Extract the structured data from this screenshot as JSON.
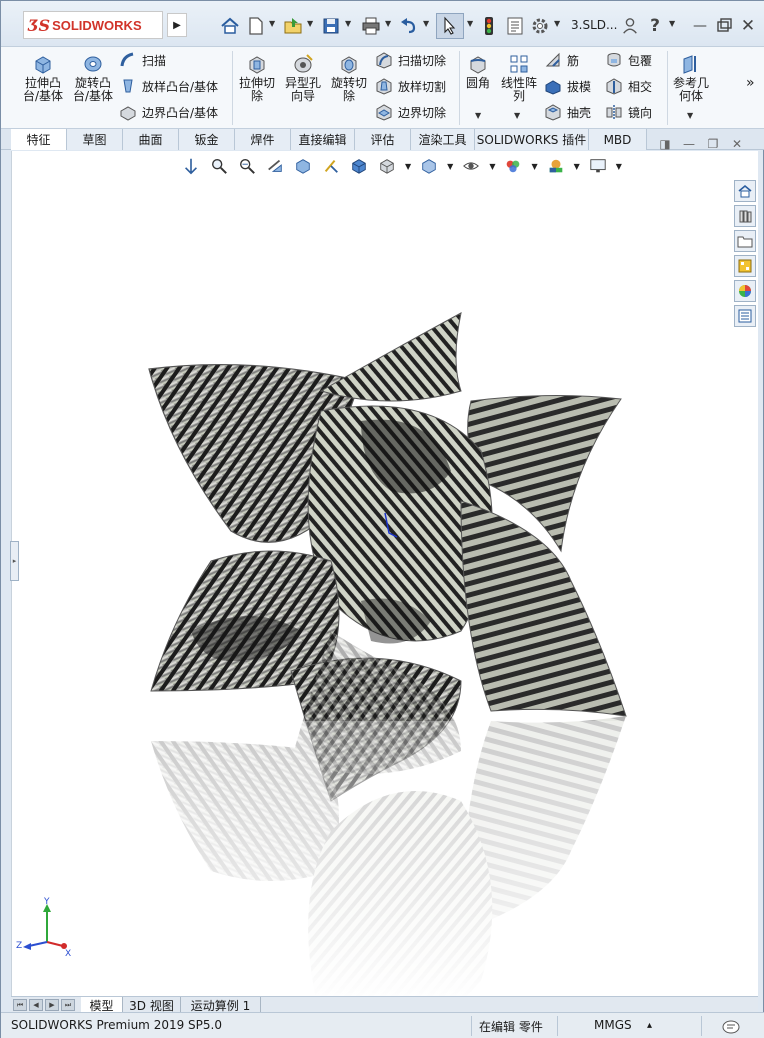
{
  "app": {
    "logo_text": "SOLIDWORKS",
    "file_name": "3.SLD..."
  },
  "quick_access": {
    "icons": [
      "home-icon",
      "new-document-icon",
      "open-icon",
      "save-icon",
      "print-icon",
      "undo-icon",
      "select-icon",
      "rebuild-icon",
      "file-properties-icon",
      "options-icon",
      "user-icon",
      "help-icon",
      "minimize-icon",
      "close-icon"
    ]
  },
  "ribbon": {
    "extrude_boss": "拉伸凸\n台/基体",
    "revolve_boss": "旋转凸\n台/基体",
    "sweep": "扫描",
    "loft_boss": "放样凸台/基体",
    "boundary_boss": "边界凸台/基体",
    "extrude_cut": "拉伸切\n除",
    "hole_wizard": "异型孔\n向导",
    "revolve_cut": "旋转切\n除",
    "swept_cut": "扫描切除",
    "lofted_cut": "放样切割",
    "boundary_cut": "边界切除",
    "fillet": "圆角",
    "linear_pattern": "线性阵\n列",
    "rib": "筋",
    "draft": "拔模",
    "shell": "抽壳",
    "wrap": "包覆",
    "intersect": "相交",
    "mirror": "镜向",
    "reference_geometry": "参考几\n何体",
    "more": "»"
  },
  "tabs": [
    "特征",
    "草图",
    "曲面",
    "钣金",
    "焊件",
    "直接编辑",
    "评估",
    "渲染工具",
    "SOLIDWORKS 插件",
    "MBD"
  ],
  "active_tab": "特征",
  "bottom_tabs": [
    "模型",
    "3D 视图",
    "运动算例 1"
  ],
  "status": {
    "product": "SOLIDWORKS Premium 2019 SP5.0",
    "mode": "在编辑 零件",
    "units": "MMGS",
    "units_caret": "▴"
  },
  "triad": {
    "x": "X",
    "y": "Y",
    "z": "Z"
  },
  "colors": {
    "brand_red": "#d1342a",
    "ribbon_bg": "#f5f8fb",
    "tab_bg": "#dde6f0"
  }
}
